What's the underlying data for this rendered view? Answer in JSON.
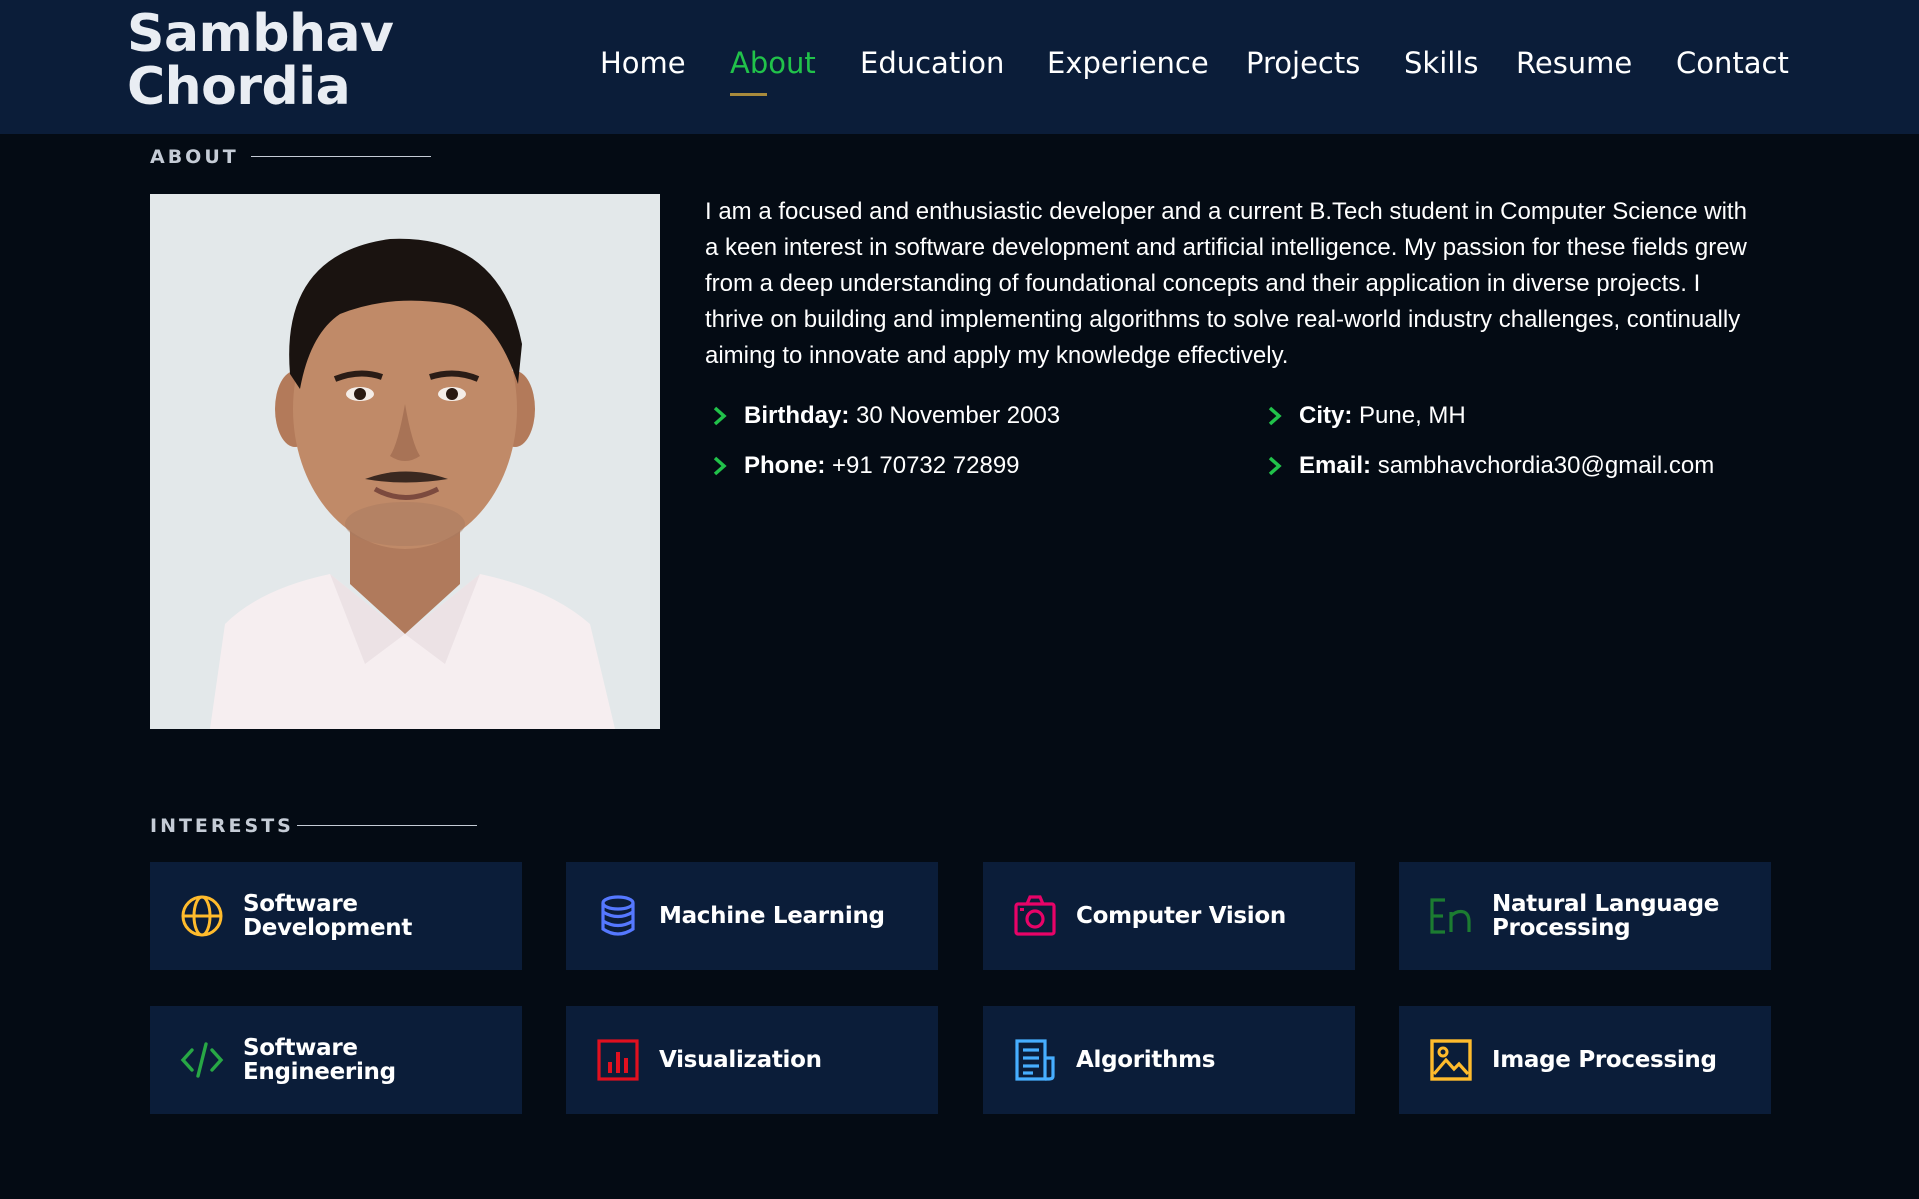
{
  "header": {
    "logo_line1": "Sambhav",
    "logo_line2": "Chordia",
    "nav": [
      {
        "label": "Home"
      },
      {
        "label": "About"
      },
      {
        "label": "Education"
      },
      {
        "label": "Experience"
      },
      {
        "label": "Projects"
      },
      {
        "label": "Skills"
      },
      {
        "label": "Resume"
      },
      {
        "label": "Contact"
      }
    ],
    "active_nav": "About"
  },
  "about": {
    "title": "ABOUT",
    "bio": "I am a focused and enthusiastic developer and a current B.Tech student in Computer Science with a keen interest in software development and artificial intelligence. My passion for these fields grew from a deep understanding of foundational concepts and their application in diverse projects. I thrive on building and implementing algorithms to solve real-world industry challenges, continually aiming to innovate and apply my knowledge effectively.",
    "info": {
      "birthday_label": "Birthday:",
      "birthday": "30 November 2003",
      "city_label": "City:",
      "city": "Pune, MH",
      "phone_label": "Phone:",
      "phone": "+91 70732 72899",
      "email_label": "Email:",
      "email": "sambhavchordia30@gmail.com"
    }
  },
  "interests": {
    "title": "INTERESTS",
    "items": [
      {
        "line1": "Software",
        "line2": "Development",
        "icon": "globe-icon",
        "color": "#ffbb2c"
      },
      {
        "line1": "Machine Learning",
        "line2": "",
        "icon": "database-icon",
        "color": "#5578ff"
      },
      {
        "line1": "Computer Vision",
        "line2": "",
        "icon": "camera-icon",
        "color": "#e80368"
      },
      {
        "line1": "Natural Language",
        "line2": "Processing",
        "icon": "translate-icon",
        "color": "#1c7c31"
      },
      {
        "line1": "Software",
        "line2": "Engineering",
        "icon": "code-icon",
        "color": "#28a745"
      },
      {
        "line1": "Visualization",
        "line2": "",
        "icon": "bar-chart-icon",
        "color": "#e2101f"
      },
      {
        "line1": "Algorithms",
        "line2": "",
        "icon": "document-icon",
        "color": "#47aeff"
      },
      {
        "line1": "Image Processing",
        "line2": "",
        "icon": "image-icon",
        "color": "#ffbb2c"
      }
    ]
  },
  "colors": {
    "accent": "#21c24a",
    "header_bg": "#0b1d39",
    "page_bg": "#040b14",
    "card_bg": "#0b1d39"
  }
}
